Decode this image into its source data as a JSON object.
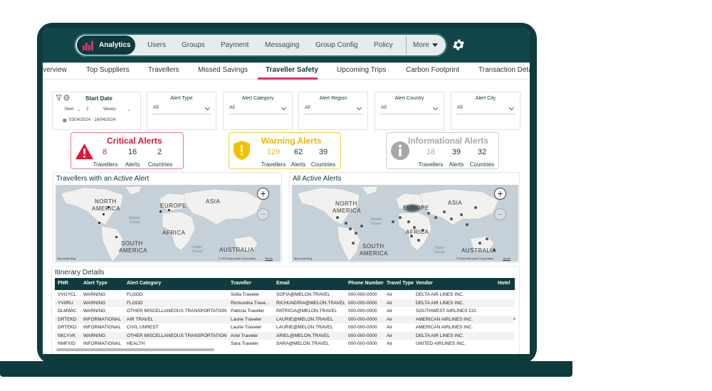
{
  "nav": {
    "active": "Analytics",
    "items": [
      "Users",
      "Groups",
      "Payment",
      "Messaging",
      "Group Config",
      "Policy"
    ],
    "more": "More"
  },
  "tabs": [
    "verview",
    "Top Suppliers",
    "Travellers",
    "Missed Savings",
    "Traveller Safety",
    "Upcoming Trips",
    "Carbon Footprint",
    "Transaction Deta"
  ],
  "filters": {
    "start_date": {
      "title": "Start Date",
      "direction": "Next",
      "count": "2",
      "unit": "Weeks",
      "range": "03/04/2024 - 16/04/2024"
    },
    "dropdowns": [
      {
        "title": "Alert Type",
        "value": "All"
      },
      {
        "title": "Alert Category",
        "value": "All"
      },
      {
        "title": "Alert Region",
        "value": "All"
      },
      {
        "title": "Alert Country",
        "value": "All"
      },
      {
        "title": "Alert City",
        "value": "All"
      }
    ]
  },
  "alerts": {
    "labels": [
      "Travellers",
      "Alerts",
      "Countries"
    ],
    "critical": {
      "title": "Critical Alerts",
      "travellers": "8",
      "alerts": "16",
      "countries": "2"
    },
    "warning": {
      "title": "Warning Alerts",
      "travellers": "129",
      "alerts": "62",
      "countries": "39"
    },
    "informational": {
      "title": "Informational Alerts",
      "travellers": "18",
      "alerts": "39",
      "countries": "32"
    }
  },
  "maps": {
    "left_title": "Travellers with an Active Alert",
    "right_title": "All Active Alerts",
    "labels": {
      "na1": "NORTH",
      "na2": "AMERICA",
      "eu": "EUROPE",
      "as": "ASIA",
      "af": "AFRICA",
      "sa1": "SOUTH",
      "sa2": "AMERICA",
      "au": "AUSTRALIA",
      "ao1": "Atlantic",
      "ao2": "Ocean",
      "io1": "Indian",
      "io2": "Ocean"
    },
    "attribution": "© 2024 Microsoft Corporation",
    "terms": "Terms",
    "bing": "Microsoft Bing"
  },
  "table": {
    "title": "Itinerary Details",
    "columns": [
      "PNR",
      "Alert Type",
      "Alert Category",
      "Traveller",
      "Email",
      "Phone Number",
      "Travel Type",
      "Vendor",
      "Hotel"
    ],
    "rows": [
      [
        "VVGYCL",
        "WARNING",
        "FLOOD",
        "Sofia Traveler",
        "SOFIA@MELON.TRAVEL",
        "000-000-0000",
        "Air",
        "DELTA AIR LINES INC."
      ],
      [
        "YVIIRU",
        "WARNING",
        "FLOOD",
        "Richundria Trave...",
        "RICHUNDRIA@MELON.TRAVEL",
        "000-000-0000",
        "Air",
        "DELTA AIR LINES INC."
      ],
      [
        "DLMWIC",
        "WARNING",
        "OTHER MISCELLANEOUS TRANSPORTATION",
        "Patricia Traveler",
        "PATRICIA@MELON.TRAVEL",
        "000-000-0000",
        "Air",
        "SOUTHWEST AIRLINES CO."
      ],
      [
        "DRTEKD",
        "INFORMATIONAL",
        "AIR TRAVEL",
        "Laurie Traveler",
        "LAURIE@MELON.TRAVEL",
        "000-000-0000",
        "Air",
        "AMERICAN AIRLINES INC."
      ],
      [
        "DRTEKD",
        "INFORMATIONAL",
        "CIVIL UNREST",
        "Laurie Traveler",
        "LAURIE@MELON.TRAVEL",
        "000-000-0000",
        "Air",
        "AMERICAN AIRLINES INC."
      ],
      [
        "NKLYVK",
        "WARNING",
        "OTHER MISCELLANEOUS TRANSPORTATION",
        "Ariel Traveler",
        "ARIEL@MELON.TRAVEL",
        "000-000-0000",
        "Air",
        "DELTA AIR LINES INC."
      ],
      [
        "NMFXID",
        "INFORMATIONAL",
        "HEALTH",
        "Sara Traveler",
        "SARA@MELON.TRAVEL",
        "000-000-0000",
        "Air",
        "UNITED AIRLINES INC."
      ]
    ]
  },
  "colors": {
    "brand": "#0f3b3e",
    "accent": "#d7336b",
    "critical": "#e2153a",
    "warning": "#f2c200",
    "info": "#a7a7a7"
  }
}
